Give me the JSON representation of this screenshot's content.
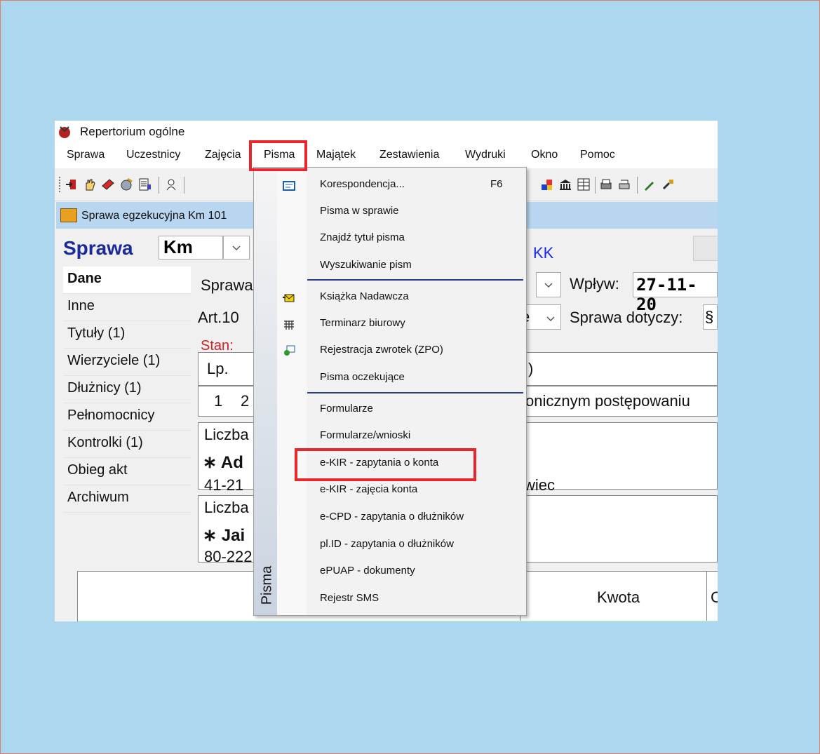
{
  "window": {
    "title": "Repertorium ogólne"
  },
  "menubar": {
    "items": [
      "Sprawa",
      "Uczestnicy",
      "Zajęcia",
      "Pisma",
      "Majątek",
      "Zestawienia",
      "Wydruki",
      "Okno",
      "Pomoc"
    ],
    "active": "Pisma"
  },
  "child_window": {
    "title": "Sprawa egzekucyjna  Km 101"
  },
  "case": {
    "label": "Sprawa",
    "prefix": "Km",
    "kk_label": "KK",
    "received_label": "Wpływ:",
    "received_value": "27-11-20",
    "concerns_label": "Sprawa dotyczy:",
    "concerns_value": "§",
    "status_label": "Stan:",
    "row1_text": "Sprawa",
    "row2_text": "Art.10",
    "row2_field": "e",
    "table_hdr_lp": "Lp.",
    "table_hdr_close": ")",
    "table_row_lp": "1",
    "table_row_val": "2",
    "table_row_text": "onicznym postępowaniu",
    "liczba1": "Liczba",
    "addr1_name": "Ad",
    "addr1_zip": "41-21",
    "addr1_city": "wiec",
    "liczba2": "Liczba",
    "addr2_name": "Jai",
    "addr2_zip": "80-222",
    "kwota_label": "Kwota",
    "col_c": "C"
  },
  "sidebar": {
    "items": [
      "Dane",
      "Inne",
      "Tytuły (1)",
      "Wierzyciele (1)",
      "Dłużnicy (1)",
      "Pełnomocnicy",
      "Kontrolki (1)",
      "Obieg akt",
      "Archiwum"
    ],
    "selected": "Dane"
  },
  "dropdown": {
    "strip_label": "Pisma",
    "items": [
      {
        "label": "Korespondencja...",
        "shortcut": "F6"
      },
      {
        "label": "Pisma w sprawie"
      },
      {
        "label": "Znajdź tytuł pisma"
      },
      {
        "label": "Wyszukiwanie pism"
      },
      {
        "label": "Książka Nadawcza"
      },
      {
        "label": "Terminarz biurowy"
      },
      {
        "label": "Rejestracja zwrotek (ZPO)"
      },
      {
        "label": "Pisma oczekujące"
      },
      {
        "label": "Formularze"
      },
      {
        "label": "Formularze/wnioski"
      },
      {
        "label": "e-KIR - zapytania o konta"
      },
      {
        "label": "e-KIR - zajęcia konta"
      },
      {
        "label": "e-CPD - zapytania o dłużników"
      },
      {
        "label": "pl.ID - zapytania o dłużników"
      },
      {
        "label": "ePUAP - dokumenty"
      },
      {
        "label": "Rejestr SMS"
      }
    ],
    "highlighted": "e-KIR - zapytania o konta"
  },
  "colors": {
    "background": "#acd7ef",
    "highlight": "#e8262b",
    "title_blue": "#1a2a9a",
    "separator": "#2c3a8a"
  }
}
